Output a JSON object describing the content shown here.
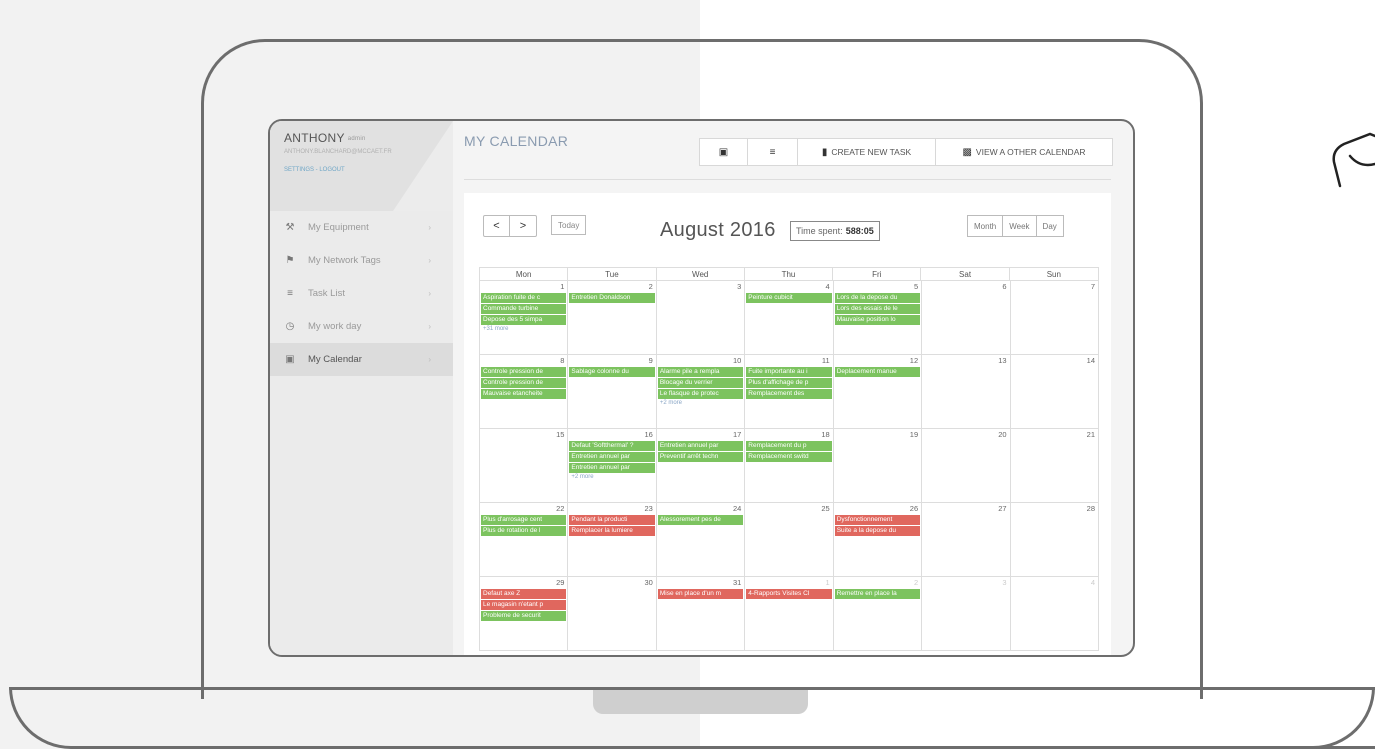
{
  "sidebar": {
    "user_name": "ANTHONY",
    "user_role": "admin",
    "user_email": "ANTHONY.BLANCHARD@MCCAET.FR",
    "user_links": "SETTINGS - LOGOUT",
    "items": [
      {
        "label": "My Equipment",
        "icon": "wrench-icon"
      },
      {
        "label": "My Network Tags",
        "icon": "tag-icon"
      },
      {
        "label": "Task List",
        "icon": "list-icon"
      },
      {
        "label": "My work day",
        "icon": "clock-icon"
      },
      {
        "label": "My Calendar",
        "icon": "calendar-icon"
      }
    ]
  },
  "header": {
    "title": "MY CALENDAR",
    "create_task": "CREATE NEW TASK",
    "view_other": "VIEW A OTHER CALENDAR"
  },
  "calendar": {
    "prev": "<",
    "next": ">",
    "today": "Today",
    "month_title": "August 2016",
    "time_spent_label": "Time spent:",
    "time_spent_value": "588:05",
    "views": [
      "Month",
      "Week",
      "Day"
    ],
    "weekdays": [
      "Mon",
      "Tue",
      "Wed",
      "Thu",
      "Fri",
      "Sat",
      "Sun"
    ],
    "weeks": [
      [
        {
          "day": "1",
          "events": [
            {
              "t": "Aspiration fuite de c",
              "c": "g"
            },
            {
              "t": "Commande turbine",
              "c": "g"
            },
            {
              "t": "Depose des 5 simpa",
              "c": "g"
            }
          ],
          "more": "+31 more"
        },
        {
          "day": "2",
          "events": [
            {
              "t": "Entretien Donaldson",
              "c": "g"
            }
          ]
        },
        {
          "day": "3",
          "events": []
        },
        {
          "day": "4",
          "events": [
            {
              "t": "Peinture cubicit",
              "c": "g"
            }
          ]
        },
        {
          "day": "5",
          "events": [
            {
              "t": "Lors de la depose du",
              "c": "g"
            },
            {
              "t": "Lors des essais de le",
              "c": "g"
            },
            {
              "t": "Mauvaise position lo",
              "c": "g"
            }
          ]
        },
        {
          "day": "6",
          "events": []
        },
        {
          "day": "7",
          "events": []
        }
      ],
      [
        {
          "day": "8",
          "events": [
            {
              "t": "Controle pression de",
              "c": "g"
            },
            {
              "t": "Controle pression de",
              "c": "g"
            },
            {
              "t": "Mauvaise etancheite",
              "c": "g"
            }
          ]
        },
        {
          "day": "9",
          "events": [
            {
              "t": "Sablage colonne du",
              "c": "g"
            }
          ]
        },
        {
          "day": "10",
          "events": [
            {
              "t": "Alarme pile a rempla",
              "c": "g"
            },
            {
              "t": "Blocage du verrier",
              "c": "g"
            },
            {
              "t": "Le flasque de protec",
              "c": "g"
            }
          ],
          "more": "+2 more"
        },
        {
          "day": "11",
          "events": [
            {
              "t": "Fuite importante au i",
              "c": "g"
            },
            {
              "t": "Plus d'affichage de p",
              "c": "g"
            },
            {
              "t": "Remplacement des",
              "c": "g"
            }
          ]
        },
        {
          "day": "12",
          "events": [
            {
              "t": "Deplacement manue",
              "c": "g"
            }
          ]
        },
        {
          "day": "13",
          "events": []
        },
        {
          "day": "14",
          "events": []
        }
      ],
      [
        {
          "day": "15",
          "events": []
        },
        {
          "day": "16",
          "events": [
            {
              "t": "Defaut 'Softthermal' ?",
              "c": "g"
            },
            {
              "t": "Entretien annuel par",
              "c": "g"
            },
            {
              "t": "Entretien annuel par",
              "c": "g"
            }
          ],
          "more": "+2 more"
        },
        {
          "day": "17",
          "events": [
            {
              "t": "Entretien annuel par",
              "c": "g"
            },
            {
              "t": "Preventif arrêt techn",
              "c": "g"
            }
          ]
        },
        {
          "day": "18",
          "events": [
            {
              "t": "Remplacement du p",
              "c": "g"
            },
            {
              "t": "Remplacement switd",
              "c": "g"
            }
          ]
        },
        {
          "day": "19",
          "events": []
        },
        {
          "day": "20",
          "events": []
        },
        {
          "day": "21",
          "events": []
        }
      ],
      [
        {
          "day": "22",
          "events": [
            {
              "t": "Plus d'arrosage cent",
              "c": "g"
            },
            {
              "t": "Plus de rotation de l",
              "c": "g"
            }
          ]
        },
        {
          "day": "23",
          "events": [
            {
              "t": "Pendant la producti",
              "c": "r"
            },
            {
              "t": "Remplacer la lumiere",
              "c": "r"
            }
          ]
        },
        {
          "day": "24",
          "events": [
            {
              "t": "Alessorement pes de",
              "c": "g"
            }
          ]
        },
        {
          "day": "25",
          "events": []
        },
        {
          "day": "26",
          "events": [
            {
              "t": "Dysfonctionnement",
              "c": "r"
            },
            {
              "t": "Suite a la depose du",
              "c": "r"
            }
          ]
        },
        {
          "day": "27",
          "events": []
        },
        {
          "day": "28",
          "events": []
        }
      ],
      [
        {
          "day": "29",
          "events": [
            {
              "t": "Defaut axe Z",
              "c": "r"
            },
            {
              "t": "Le magasin n'etant p",
              "c": "r"
            },
            {
              "t": "Probleme de securit",
              "c": "g"
            }
          ]
        },
        {
          "day": "30",
          "events": []
        },
        {
          "day": "31",
          "events": [
            {
              "t": "Mise en place d'un m",
              "c": "r"
            }
          ]
        },
        {
          "day": "1",
          "other": true,
          "events": [
            {
              "t": "4-Rapports Visites Cl",
              "c": "r"
            }
          ]
        },
        {
          "day": "2",
          "other": true,
          "events": [
            {
              "t": "Remettre en place la",
              "c": "g"
            }
          ]
        },
        {
          "day": "3",
          "other": true,
          "events": []
        },
        {
          "day": "4",
          "other": true,
          "events": []
        }
      ]
    ]
  }
}
